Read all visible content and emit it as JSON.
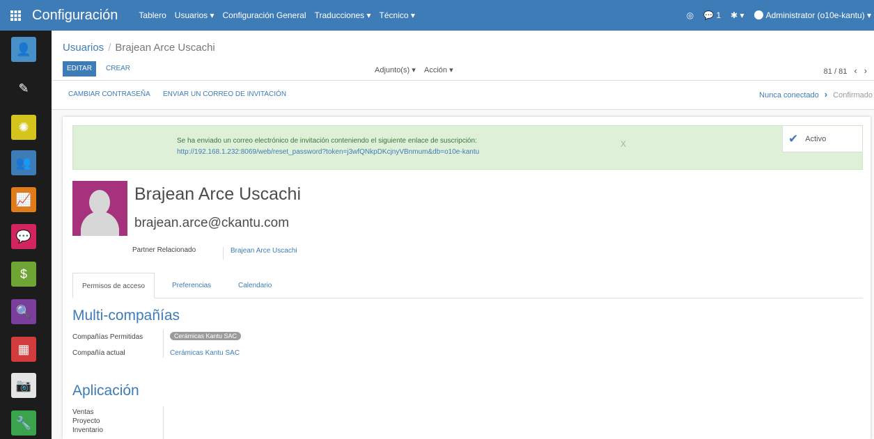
{
  "app": {
    "title": "Configuración"
  },
  "topmenu": [
    "Tablero",
    "Usuarios ▾",
    "Configuración General",
    "Traducciones ▾",
    "Técnico ▾"
  ],
  "topright": {
    "messages_count": "1",
    "bug_label": "▾",
    "user": "Administrator (o10e-kantu) ▾"
  },
  "breadcrumb": {
    "parent": "Usuarios",
    "separator": "/",
    "current": "Brajean Arce Uscachi"
  },
  "buttons": {
    "edit": "EDITAR",
    "create": "CREAR"
  },
  "dropdowns": {
    "attachments": "Adjunto(s) ▾",
    "action": "Acción ▾"
  },
  "pager": {
    "value": "81 / 81",
    "prev": "‹",
    "next": "›"
  },
  "header_buttons": {
    "change_password": "CAMBIAR CONTRASEÑA",
    "send_invite": "ENVIAR UN CORREO DE INVITACIÓN"
  },
  "states": {
    "current": "Nunca conectado",
    "arrow": "›",
    "next": "Confirmado"
  },
  "alert": {
    "message": "Se ha enviado un correo electrónico de invitación conteniendo el siguiente enlace de suscripción:",
    "url": "http://192.168.1.232:8069/web/reset_password?token=j3wfQNkpDKcjnyVBnmum&db=o10e-kantu",
    "close": "X"
  },
  "active_toggle": {
    "label": "Activo"
  },
  "user": {
    "name": "Brajean Arce Uscachi",
    "email": "brajean.arce@ckantu.com",
    "partner_label": "Partner Relacionado",
    "partner_value": "Brajean Arce Uscachi"
  },
  "tabs": [
    "Permisos de acceso",
    "Preferencias",
    "Calendario"
  ],
  "multicompany": {
    "title": "Multi-compañías",
    "allowed_label": "Compañías Permitidas",
    "allowed_value": "Cerámicas Kantu SAC",
    "current_label": "Compañía actual",
    "current_value": "Cerámicas Kantu SAC"
  },
  "application": {
    "title": "Aplicación",
    "items": [
      "Ventas",
      "Proyecto",
      "Inventario"
    ]
  },
  "colors": {
    "primary": "#3e7cb8",
    "sidebar": "#1c1c1c",
    "alert_bg": "#dff0d8"
  }
}
